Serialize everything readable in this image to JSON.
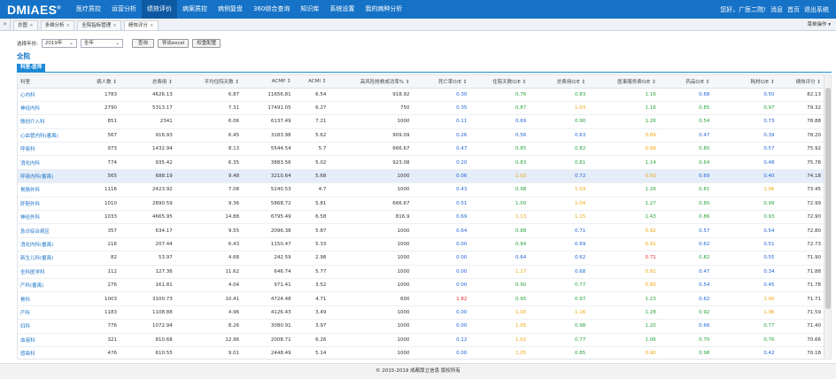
{
  "app": {
    "logo": "DMIAES",
    "logo_mark": "®",
    "nav": [
      "医疗质控",
      "运营分析",
      "绩效评价",
      "病案质控",
      "病例复盘",
      "360综合查询",
      "知识库",
      "系统设置",
      "我的病种分析"
    ],
    "active_nav": "绩效评价",
    "greeting": "您好，广医二院!",
    "messages": "消息",
    "home": "首页",
    "logout": "退出系统"
  },
  "tabs": [
    {
      "label": "总图",
      "close": "×"
    },
    {
      "label": "多维分析",
      "close": "×"
    },
    {
      "label": "全院指标管理",
      "close": "×"
    },
    {
      "label": "绩效评分",
      "close": "×"
    }
  ],
  "tab_menu": "菜单操作 ▾",
  "collapse_glyph": "»",
  "filter": {
    "year_label": "选择年份:",
    "year": "2019年",
    "period": "全年",
    "query": "查询",
    "export": "导出excel",
    "weights": "权重配置"
  },
  "hospital_title": "全院",
  "section_tab": "科室-医师",
  "table": {
    "headers": [
      "科室",
      "病人数 ↕",
      "总费用 ↕",
      "平均住院天数 ↕",
      "ACMP ↕",
      "ACMI ↕",
      "高风险抢救成功率% ↕",
      "死亡率O/E ↕",
      "住院天数O/E ↕",
      "总费用O/E ↕",
      "医事服务费O/E ↕",
      "药品O/E ↕",
      "耗材O/E ↕",
      "绩效评分 ↕"
    ],
    "rows": [
      [
        "心内科",
        "1783",
        "4626.13",
        "6.87",
        "11656.81",
        "6.54",
        "918.92",
        "0.30",
        "0.76",
        "0.83",
        "1.16",
        "0.68",
        "0.50",
        "82.13"
      ],
      [
        "神经内科",
        "2790",
        "5313.17",
        "7.31",
        "17491.05",
        "6.27",
        "750",
        "0.35",
        "0.87",
        "1.03",
        "1.16",
        "0.85",
        "0.97",
        "79.32"
      ],
      [
        "微创介入科",
        "851",
        "2341",
        "6.06",
        "6137.49",
        "7.21",
        "1000",
        "0.11",
        "0.69",
        "0.90",
        "1.26",
        "0.54",
        "0.73",
        "78.88"
      ],
      [
        "心血管内科(番禺)",
        "567",
        "916.93",
        "6.45",
        "3183.98",
        "5.62",
        "909.09",
        "0.26",
        "0.56",
        "0.63",
        "0.89",
        "0.47",
        "0.39",
        "78.20"
      ],
      [
        "呼吸科",
        "973",
        "1432.94",
        "8.13",
        "5544.54",
        "5.7",
        "666.67",
        "0.47",
        "0.85",
        "0.82",
        "0.99",
        "0.80",
        "0.57",
        "75.92"
      ],
      [
        "消化内科",
        "774",
        "935.42",
        "6.35",
        "3883.56",
        "5.02",
        "923.08",
        "0.20",
        "0.83",
        "0.81",
        "1.14",
        "0.64",
        "0.48",
        "75.78"
      ],
      [
        "呼吸内科(番禺)",
        "565",
        "688.19",
        "9.48",
        "3210.64",
        "5.68",
        "1000",
        "0.06",
        "1.03",
        "0.72",
        "0.93",
        "0.69",
        "0.40",
        "74.18"
      ],
      [
        "胃肠外科",
        "1116",
        "2423.92",
        "7.08",
        "5240.53",
        "4.7",
        "1000",
        "0.43",
        "0.98",
        "1.03",
        "1.26",
        "0.81",
        "1.06",
        "73.45"
      ],
      [
        "肝胆外科",
        "1010",
        "2890.59",
        "9.36",
        "5868.72",
        "5.81",
        "666.67",
        "0.51",
        "1.00",
        "1.04",
        "1.27",
        "0.80",
        "0.99",
        "72.99"
      ],
      [
        "神经外科",
        "1033",
        "4665.95",
        "14.88",
        "6795.49",
        "6.58",
        "816.9",
        "0.69",
        "1.13",
        "1.15",
        "1.43",
        "0.86",
        "0.93",
        "72.90"
      ],
      [
        "急诊综合病区",
        "357",
        "634.17",
        "9.55",
        "2096.38",
        "5.87",
        "1000",
        "0.64",
        "0.88",
        "0.71",
        "0.92",
        "0.57",
        "0.54",
        "72.80"
      ],
      [
        "消化内科(番禺)",
        "216",
        "207.44",
        "6.43",
        "1150.47",
        "5.33",
        "1000",
        "0.00",
        "0.84",
        "0.69",
        "0.91",
        "0.62",
        "0.51",
        "72.73"
      ],
      [
        "新生儿科(番禺)",
        "82",
        "53.97",
        "4.68",
        "242.59",
        "2.98",
        "1000",
        "0.00",
        "0.64",
        "0.62",
        "0.71",
        "0.82",
        "0.55",
        "71.90"
      ],
      [
        "全科医学科",
        "112",
        "127.36",
        "11.62",
        "646.74",
        "5.77",
        "1000",
        "0.00",
        "1.17",
        "0.68",
        "0.91",
        "0.47",
        "0.34",
        "71.88"
      ],
      [
        "产科(番禺)",
        "276",
        "161.81",
        "4.04",
        "971.41",
        "3.52",
        "1000",
        "0.00",
        "0.90",
        "0.77",
        "0.80",
        "0.54",
        "0.45",
        "71.78"
      ],
      [
        "骨科",
        "1003",
        "3100.73",
        "10.41",
        "4724.48",
        "4.71",
        "600",
        "1.82",
        "0.95",
        "0.97",
        "1.23",
        "0.62",
        "1.00",
        "71.71"
      ],
      [
        "产科",
        "1183",
        "1108.88",
        "4.96",
        "4126.43",
        "3.49",
        "1000",
        "0.00",
        "1.00",
        "1.16",
        "1.28",
        "0.92",
        "1.06",
        "71.59"
      ],
      [
        "妇科",
        "776",
        "1072.94",
        "8.26",
        "3080.91",
        "3.97",
        "1000",
        "0.00",
        "1.05",
        "0.98",
        "1.20",
        "0.66",
        "0.77",
        "71.40"
      ],
      [
        "血液科",
        "321",
        "810.68",
        "12.96",
        "2008.71",
        "6.26",
        "1000",
        "0.12",
        "1.02",
        "0.77",
        "1.06",
        "0.70",
        "0.76",
        "70.66"
      ],
      [
        "感染科",
        "476",
        "610.55",
        "9.01",
        "2448.49",
        "5.14",
        "1000",
        "0.00",
        "1.05",
        "0.85",
        "0.90",
        "0.98",
        "0.42",
        "70.18"
      ]
    ],
    "cell_colors": [
      [
        "blue",
        "green",
        "green",
        "green",
        "blue",
        "blue"
      ],
      [
        "blue",
        "green",
        "orange",
        "green",
        "green",
        "green"
      ],
      [
        "blue",
        "blue",
        "green",
        "green",
        "green",
        "blue"
      ],
      [
        "blue",
        "blue",
        "blue",
        "orange",
        "blue",
        "blue"
      ],
      [
        "blue",
        "green",
        "green",
        "orange",
        "green",
        "blue"
      ],
      [
        "blue",
        "green",
        "green",
        "green",
        "green",
        "blue"
      ],
      [
        "blue",
        "orange",
        "blue",
        "orange",
        "blue",
        "blue"
      ],
      [
        "blue",
        "green",
        "orange",
        "green",
        "green",
        "orange"
      ],
      [
        "blue",
        "green",
        "orange",
        "green",
        "green",
        "green"
      ],
      [
        "blue",
        "orange",
        "orange",
        "green",
        "green",
        "green"
      ],
      [
        "blue",
        "green",
        "blue",
        "orange",
        "blue",
        "blue"
      ],
      [
        "blue",
        "green",
        "blue",
        "orange",
        "blue",
        "blue"
      ],
      [
        "blue",
        "blue",
        "blue",
        "red",
        "green",
        "blue"
      ],
      [
        "blue",
        "orange",
        "blue",
        "orange",
        "blue",
        "blue"
      ],
      [
        "blue",
        "green",
        "green",
        "orange",
        "blue",
        "blue"
      ],
      [
        "red",
        "green",
        "green",
        "green",
        "blue",
        "orange"
      ],
      [
        "blue",
        "orange",
        "orange",
        "green",
        "green",
        "orange"
      ],
      [
        "blue",
        "orange",
        "green",
        "green",
        "blue",
        "green"
      ],
      [
        "blue",
        "orange",
        "green",
        "green",
        "green",
        "green"
      ],
      [
        "blue",
        "orange",
        "green",
        "orange",
        "green",
        "blue"
      ]
    ],
    "highlight_row": 6
  },
  "footer": "© 2015-2019 成都厚立信息 版权所有",
  "colors": {
    "brand": "#1572c6",
    "active_nav": "#0d5aa3",
    "ok_blue": "#1f63d6",
    "ok_green": "#27a33a",
    "warn_orange": "#f0a30a",
    "bad_red": "#e02b2b"
  }
}
